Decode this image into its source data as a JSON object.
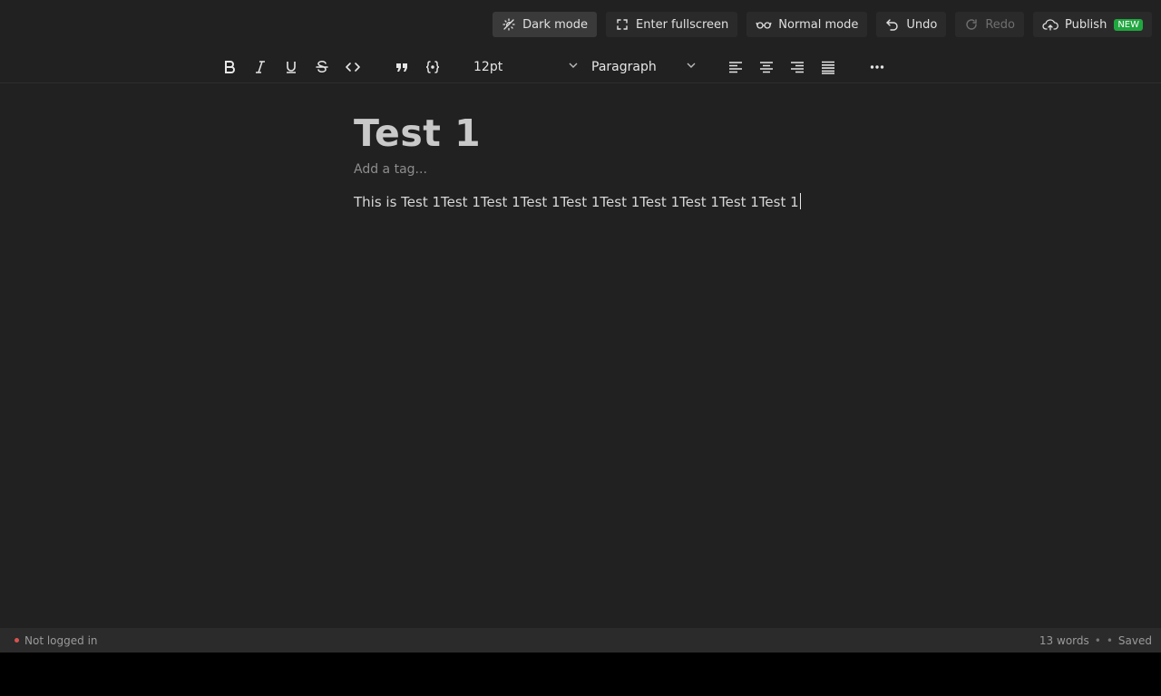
{
  "topbar": {
    "dark_mode": "Dark mode",
    "fullscreen": "Enter fullscreen",
    "normal_mode": "Normal mode",
    "undo": "Undo",
    "redo": "Redo",
    "publish": "Publish",
    "publish_badge": "NEW"
  },
  "toolbar": {
    "font_size": "12pt",
    "block_type": "Paragraph",
    "icons": [
      "bold-icon",
      "italic-icon",
      "underline-icon",
      "strikethrough-icon",
      "code-icon",
      "quote-icon",
      "code-block-icon",
      "align-left-icon",
      "align-center-icon",
      "align-right-icon",
      "align-justify-icon",
      "more-icon"
    ]
  },
  "document": {
    "title": "Test 1",
    "tag_placeholder": "Add a tag...",
    "body": "This is Test 1Test 1Test 1Test 1Test 1Test 1Test 1Test 1Test 1Test 1"
  },
  "status": {
    "login": "Not logged in",
    "word_count": "13 words",
    "bullet": "•",
    "saved": "Saved"
  },
  "colors": {
    "background": "#212121",
    "statusbar": "#2b2b2b",
    "badge": "#1fa73f",
    "status_dot": "#d9534f"
  }
}
